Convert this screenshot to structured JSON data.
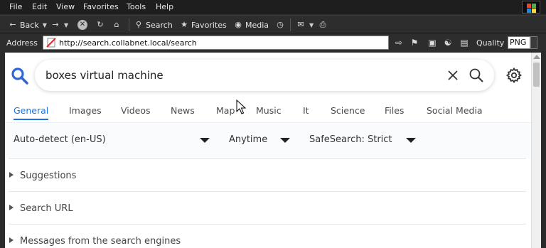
{
  "menu": [
    "File",
    "Edit",
    "View",
    "Favorites",
    "Tools",
    "Help"
  ],
  "toolbar": {
    "back": "Back",
    "search": "Search",
    "favorites": "Favorites",
    "media": "Media"
  },
  "address": {
    "label": "Address",
    "url": "http://search.collabnet.local/search",
    "quality_label": "Quality",
    "quality_value": "PNG"
  },
  "search": {
    "query": "boxes virtual machine"
  },
  "tabs": [
    {
      "label": "General",
      "active": true
    },
    {
      "label": "Images"
    },
    {
      "label": "Videos"
    },
    {
      "label": "News"
    },
    {
      "label": "Map"
    },
    {
      "label": "Music"
    },
    {
      "label": "It"
    },
    {
      "label": "Science"
    },
    {
      "label": "Files"
    },
    {
      "label": "Social Media"
    }
  ],
  "filters": {
    "language": "Auto-detect (en-US)",
    "time": "Anytime",
    "safesearch": "SafeSearch: Strict"
  },
  "sections": [
    {
      "label": "Suggestions"
    },
    {
      "label": "Search URL"
    },
    {
      "label": "Messages from the search engines"
    }
  ],
  "colors": {
    "accent": "#1a73e8",
    "chrome_bg": "#2d2d2d"
  }
}
